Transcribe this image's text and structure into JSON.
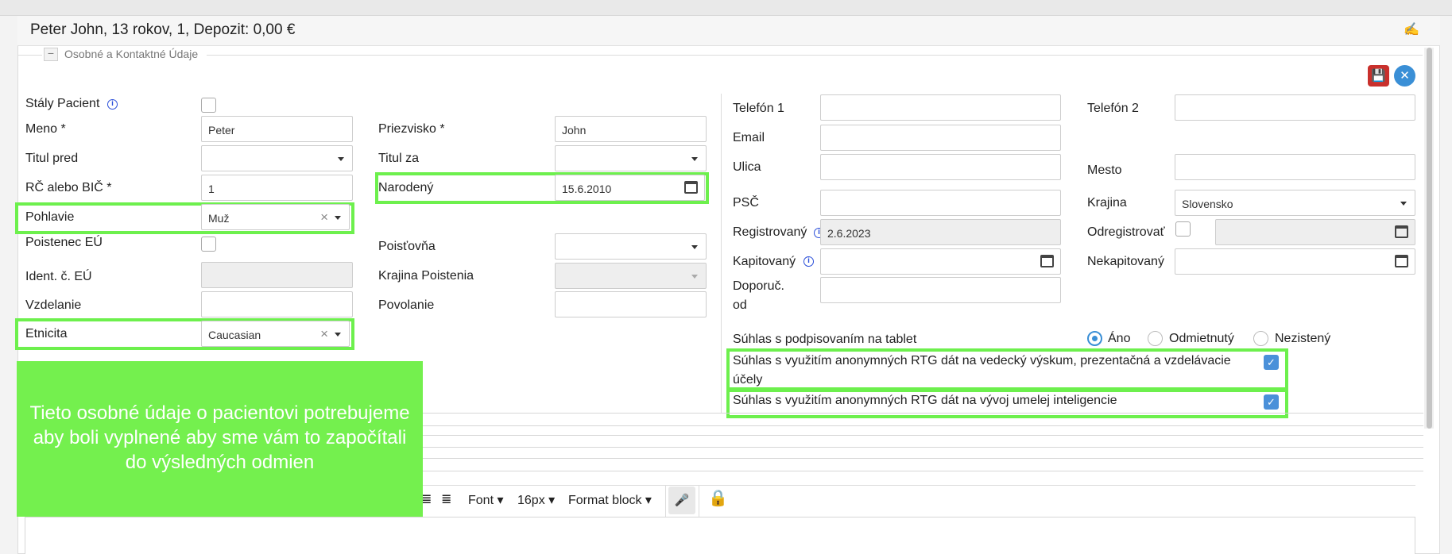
{
  "header": {
    "title": "Peter John, 13 rokov, 1, Depozit: 0,00 €"
  },
  "section": {
    "legend": "Osobné a Kontaktné Údaje",
    "collapse_symbol": "−"
  },
  "left": {
    "staly_pacient": {
      "label": "Stály Pacient",
      "checked": false
    },
    "meno": {
      "label": "Meno *",
      "value": "Peter"
    },
    "titul_pred": {
      "label": "Titul pred",
      "value": ""
    },
    "rc": {
      "label": "RČ alebo BIČ *",
      "value": "1"
    },
    "pohlavie": {
      "label": "Pohlavie",
      "value": "Muž"
    },
    "poistenec_eu": {
      "label": "Poistenec EÚ",
      "checked": false
    },
    "ident_eu": {
      "label": "Ident. č. EÚ",
      "value": ""
    },
    "vzdelanie": {
      "label": "Vzdelanie",
      "value": ""
    },
    "etnicita": {
      "label": "Etnicita",
      "value": "Caucasian"
    }
  },
  "middle": {
    "priezvisko": {
      "label": "Priezvisko *",
      "value": "John"
    },
    "titul_za": {
      "label": "Titul za",
      "value": ""
    },
    "narodeny": {
      "label": "Narodený",
      "value": "15.6.2010"
    },
    "poistovna": {
      "label": "Poisťovňa",
      "value": ""
    },
    "krajina_poistenia": {
      "label": "Krajina Poistenia",
      "value": ""
    },
    "povolanie": {
      "label": "Povolanie",
      "value": ""
    }
  },
  "contact": {
    "telefon1": {
      "label": "Telefón 1",
      "value": ""
    },
    "telefon2": {
      "label": "Telefón 2",
      "value": ""
    },
    "email": {
      "label": "Email",
      "value": ""
    },
    "ulica": {
      "label": "Ulica",
      "value": ""
    },
    "mesto": {
      "label": "Mesto",
      "value": ""
    },
    "psc": {
      "label": "PSČ",
      "value": ""
    },
    "krajina": {
      "label": "Krajina",
      "value": "Slovensko"
    },
    "registrovany": {
      "label": "Registrovaný",
      "value": "2.6.2023"
    },
    "odregistrovat": {
      "label": "Odregistrovať",
      "value": ""
    },
    "kapitovany": {
      "label": "Kapitovaný",
      "value": ""
    },
    "nekapitovany": {
      "label": "Nekapitovaný",
      "value": ""
    },
    "doporuc_line1": "Doporuč.",
    "doporuc_line2": "od"
  },
  "consent": {
    "tablet_label": "Súhlas s podpisovaním na tablet",
    "options": [
      "Áno",
      "Odmietnutý",
      "Nezistený"
    ],
    "selected": "Áno",
    "rtg_research_line1": "Súhlas s využitím anonymných RTG dát na vedecký výskum, prezentačná a vzdelávacie",
    "rtg_research_line2": "účely",
    "rtg_research_checked": true,
    "rtg_ai": "Súhlas s využitím anonymných RTG dát na vývoj umelej inteligencie",
    "rtg_ai_checked": true
  },
  "overlay": {
    "line1": "Tieto osobné údaje o pacientovi potrebujeme",
    "line2": "aby boli vyplnené aby sme vám to započítali",
    "line3": "do výsledných odmien"
  },
  "toolbar": {
    "font": "Font",
    "size": "16px",
    "format": "Format block"
  },
  "colors": {
    "highlight": "#6df04d",
    "overlay": "#74f04e",
    "save": "#c9302c",
    "close": "#3a8fd6"
  }
}
